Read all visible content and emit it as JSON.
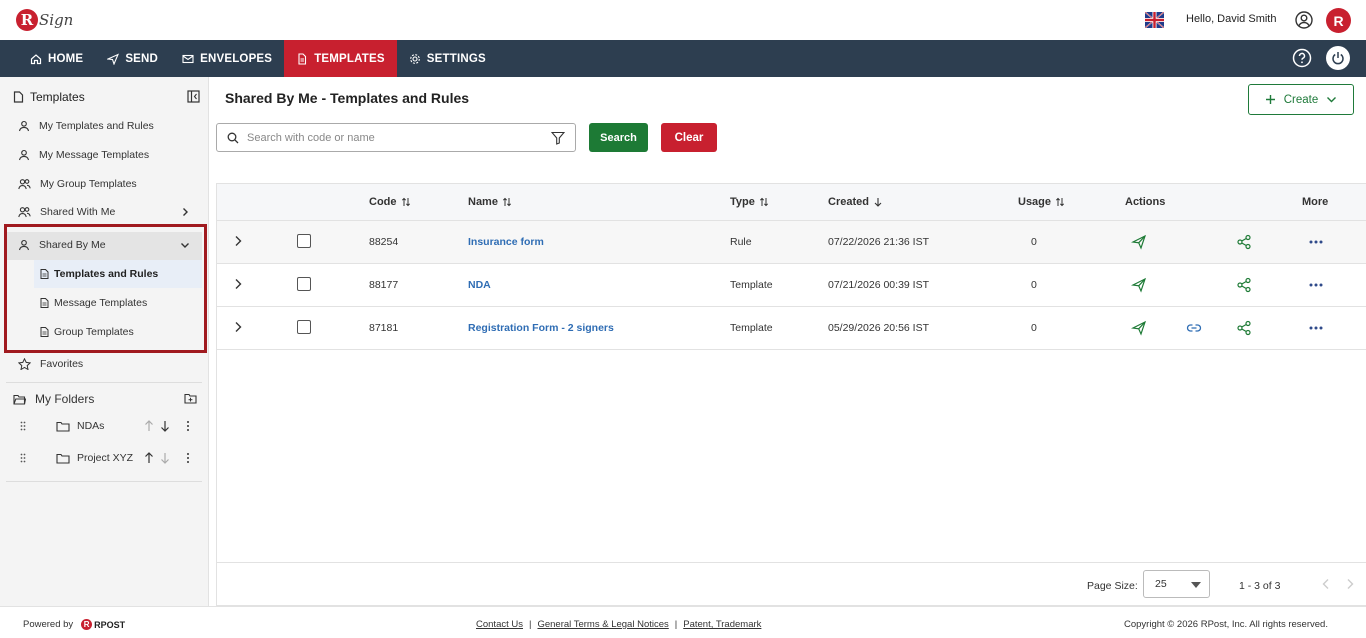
{
  "header": {
    "logo_text": "RSign",
    "greeting": "Hello, David Smith",
    "brand_letter": "R"
  },
  "nav": {
    "items": [
      {
        "label": "HOME",
        "icon": "home-icon"
      },
      {
        "label": "SEND",
        "icon": "send-icon"
      },
      {
        "label": "ENVELOPES",
        "icon": "envelope-icon"
      },
      {
        "label": "TEMPLATES",
        "icon": "document-icon",
        "active": true
      },
      {
        "label": "SETTINGS",
        "icon": "gear-icon"
      }
    ]
  },
  "sidebar": {
    "title": "Templates",
    "items": [
      {
        "label": "My Templates and Rules"
      },
      {
        "label": "My Message Templates"
      },
      {
        "label": "My Group Templates"
      },
      {
        "label": "Shared With Me"
      },
      {
        "label": "Shared By Me"
      }
    ],
    "shared_by_me_children": [
      {
        "label": "Templates and Rules",
        "active": true
      },
      {
        "label": "Message Templates"
      },
      {
        "label": "Group Templates"
      }
    ],
    "favorites": "Favorites",
    "folders_title": "My Folders",
    "folders": [
      {
        "name": "NDAs"
      },
      {
        "name": "Project XYZ"
      }
    ]
  },
  "main": {
    "title": "Shared By Me - Templates and Rules",
    "create_label": "Create",
    "search_placeholder": "Search with code or name",
    "search_label": "Search",
    "clear_label": "Clear"
  },
  "table": {
    "columns": {
      "code": "Code",
      "name": "Name",
      "type": "Type",
      "created": "Created",
      "usage": "Usage",
      "actions": "Actions",
      "more": "More"
    },
    "rows": [
      {
        "code": "88254",
        "name": "Insurance form",
        "type": "Rule",
        "created": "07/22/2026 21:36 IST",
        "usage": "0",
        "actions": [
          "send-icon",
          "share-icon"
        ]
      },
      {
        "code": "88177",
        "name": "NDA",
        "type": "Template",
        "created": "07/21/2026 00:39 IST",
        "usage": "0",
        "actions": [
          "send-icon",
          "share-icon"
        ]
      },
      {
        "code": "87181",
        "name": "Registration Form - 2 signers",
        "type": "Template",
        "created": "05/29/2026 20:56 IST",
        "usage": "0",
        "actions": [
          "send-icon",
          "link-icon",
          "share-icon"
        ]
      }
    ],
    "page_size_label": "Page Size:",
    "page_size": "25",
    "range": "1 - 3 of 3"
  },
  "footer": {
    "powered_by": "Powered by",
    "rpost": "RPOST",
    "links": [
      "Contact Us",
      "General Terms & Legal Notices",
      "Patent, Trademark"
    ],
    "copyright": "Copyright © 2026 RPost, Inc. All rights reserved."
  },
  "colors": {
    "nav_bg": "#2d3e50",
    "accent_red": "#c8202f",
    "accent_green": "#1d7a35",
    "link_blue": "#2f6db4"
  }
}
